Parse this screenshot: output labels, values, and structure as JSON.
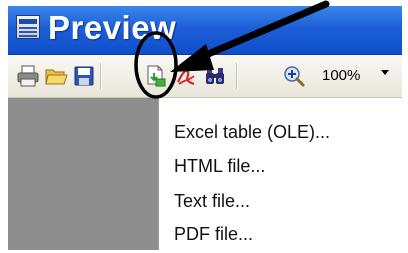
{
  "window": {
    "title": "Preview"
  },
  "toolbar": {
    "buttons": [
      {
        "name": "print-icon"
      },
      {
        "name": "open-folder-icon"
      },
      {
        "name": "save-icon"
      },
      {
        "name": "export-icon"
      },
      {
        "name": "pdf-icon"
      },
      {
        "name": "find-icon"
      },
      {
        "name": "zoom-in-icon"
      }
    ],
    "zoom_value": "100%"
  },
  "menu": {
    "items": [
      {
        "label": "Excel table (OLE)..."
      },
      {
        "label": "HTML file..."
      },
      {
        "label": "Text file..."
      },
      {
        "label": "PDF file..."
      }
    ]
  },
  "colors": {
    "titlebar": "#1d5fd8",
    "preview_pane": "#8e8e8e",
    "annotation": "#000000"
  }
}
